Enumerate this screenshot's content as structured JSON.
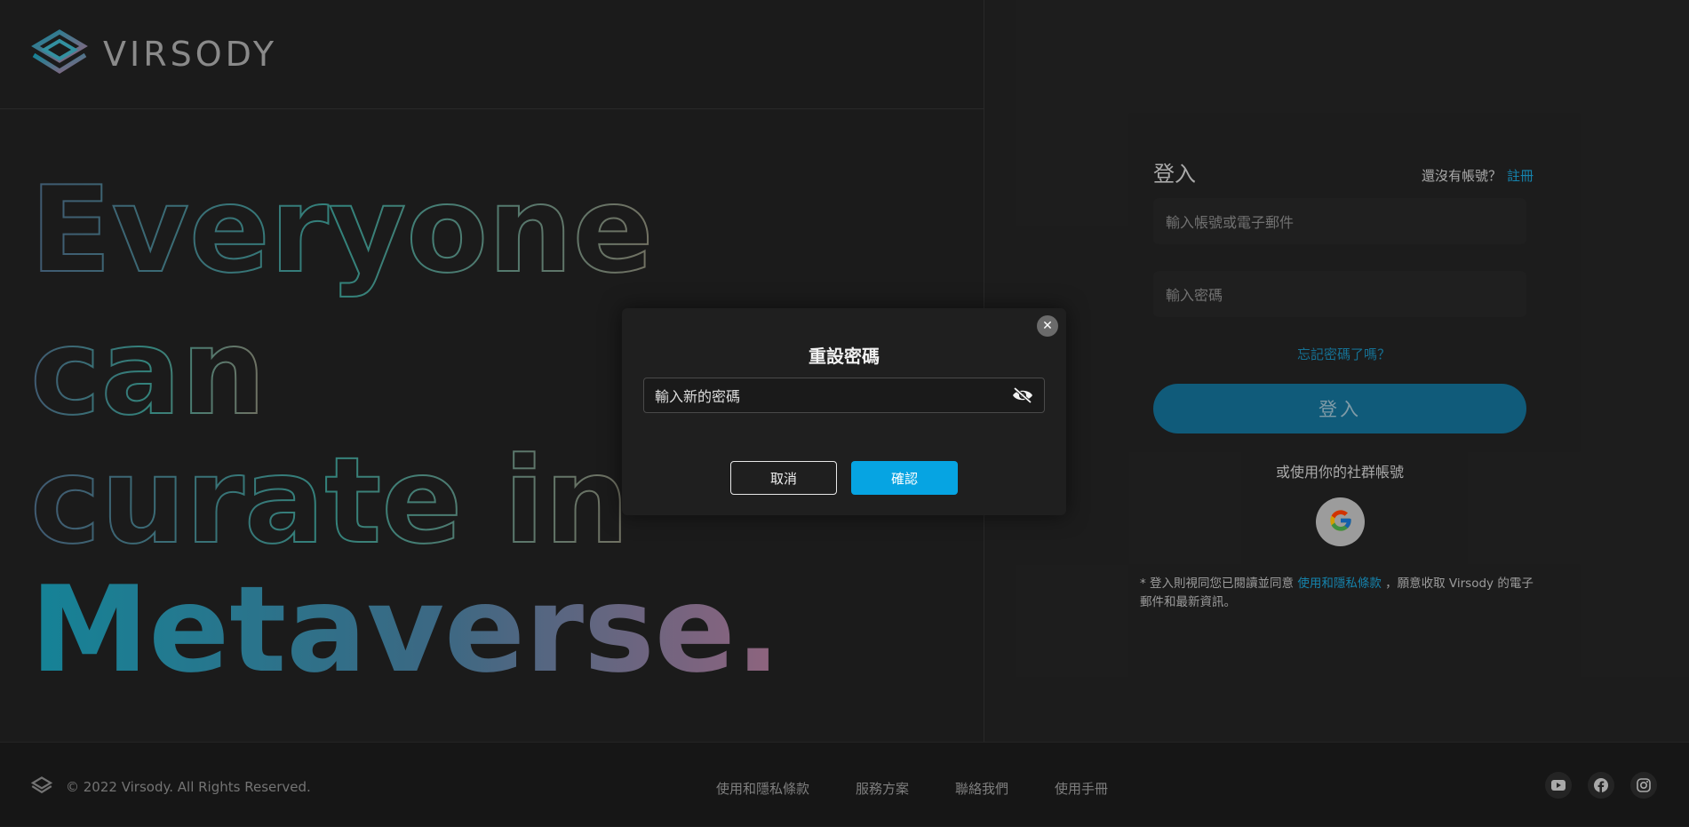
{
  "brand": {
    "name": "VIRSODY"
  },
  "hero": {
    "line1": "Everyone",
    "line2": "can",
    "line3": "curate in",
    "line4": "Metaverse."
  },
  "login": {
    "title": "登入",
    "signup_prompt": "還沒有帳號？",
    "signup_link": "註冊",
    "username_placeholder": "輸入帳號或電子郵件",
    "password_placeholder": "輸入密碼",
    "forgot": "忘記密碼了嗎？",
    "submit": "登入",
    "social_caption": "或使用你的社群帳號",
    "terms_prefix": "* 登入則視同您已閱讀並同意",
    "terms_link": "使用和隱私條款",
    "terms_suffix": "，願意收取 Virsody 的電子郵件和最新資訊。"
  },
  "modal": {
    "title": "重設密碼",
    "new_password_placeholder": "輸入新的密碼",
    "cancel": "取消",
    "confirm": "確認",
    "close_icon": "close-icon",
    "eye_icon": "eye-off-icon"
  },
  "footer": {
    "copyright": "© 2022 Virsody. All Rights Reserved.",
    "links": [
      "使用和隱私條款",
      "服務方案",
      "聯絡我們",
      "使用手冊"
    ],
    "social": [
      "youtube-icon",
      "facebook-icon",
      "instagram-icon"
    ]
  },
  "colors": {
    "accent": "#06a4e2",
    "link": "#1a9fd1",
    "login_button": "#146f95",
    "gradient_start": "#1aa0b8",
    "gradient_end": "#b07a9a"
  }
}
